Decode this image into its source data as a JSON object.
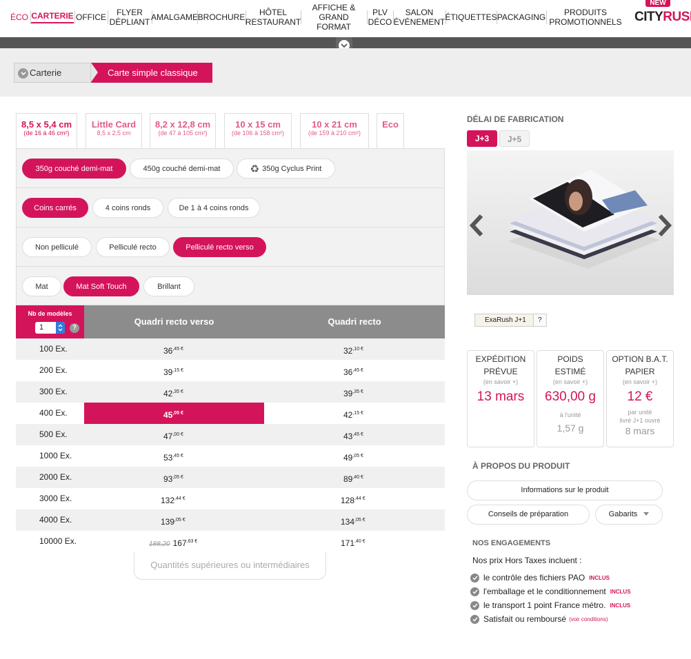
{
  "nav": {
    "items": [
      {
        "label": "ÉCO"
      },
      {
        "label": "CARTERIE"
      },
      {
        "label": "OFFICE"
      },
      {
        "label": "FLYER\nDÉPLIANT"
      },
      {
        "label": "AMALGAME"
      },
      {
        "label": "BROCHURE"
      },
      {
        "label": "HÔTEL\nRESTAURANT"
      },
      {
        "label": "AFFICHE &\nGRAND FORMAT"
      },
      {
        "label": "PLV\nDÉCO"
      },
      {
        "label": "SALON\nÉVÉNEMENT"
      },
      {
        "label": "ÉTIQUETTES"
      },
      {
        "label": "PACKAGING"
      },
      {
        "label": "PRODUITS\nPROMOTIONNELS"
      }
    ],
    "logo_badge": "NEW",
    "logo_part1": "CITY",
    "logo_part2": "RUSH"
  },
  "breadcrumb": {
    "home": "Carterie",
    "current": "Carte simple classique"
  },
  "formats": [
    {
      "title": "8,5 x 5,4 cm",
      "sub": "(de 16 à 46 cm²)"
    },
    {
      "title": "Little Card",
      "sub": "8,5 x 2,5 cm"
    },
    {
      "title": "8,2 x 12,8 cm",
      "sub": "(de 47 à 105 cm²)"
    },
    {
      "title": "10 x 15 cm",
      "sub": "(de 106 à 158 cm²)"
    },
    {
      "title": "10 x 21 cm",
      "sub": "(de 159 à 210 cm²)"
    },
    {
      "title": "Eco",
      "sub": ""
    }
  ],
  "paper": [
    "350g couché demi-mat",
    "450g couché demi-mat",
    "350g Cyclus Print"
  ],
  "corners": [
    "Coins carrés",
    "4 coins ronds",
    "De 1 à 4 coins ronds"
  ],
  "lamination": [
    "Non pelliculé",
    "Pelliculé recto",
    "Pelliculé recto verso"
  ],
  "finish": [
    "Mat",
    "Mat Soft Touch",
    "Brillant"
  ],
  "table": {
    "models_label": "Nb de modèles",
    "models_value": "1",
    "help": "?",
    "col1": "Quadri recto verso",
    "col2": "Quadri recto",
    "rows": [
      {
        "qty": "100 Ex.",
        "p1": "36",
        "p1c": ",45 €",
        "p2": "32",
        "p2c": ",10 €"
      },
      {
        "qty": "200 Ex.",
        "p1": "39",
        "p1c": ",15 €",
        "p2": "36",
        "p2c": ",45 €"
      },
      {
        "qty": "300 Ex.",
        "p1": "42",
        "p1c": ",35 €",
        "p2": "39",
        "p2c": ",35 €"
      },
      {
        "qty": "400 Ex.",
        "p1": "45",
        "p1c": ",05 €",
        "p2": "42",
        "p2c": ",15 €"
      },
      {
        "qty": "500 Ex.",
        "p1": "47",
        "p1c": ",00 €",
        "p2": "43",
        "p2c": ",45 €"
      },
      {
        "qty": "1000 Ex.",
        "p1": "53",
        "p1c": ",45 €",
        "p2": "49",
        "p2c": ",05 €"
      },
      {
        "qty": "2000 Ex.",
        "p1": "93",
        "p1c": ",05 €",
        "p2": "89",
        "p2c": ",40 €"
      },
      {
        "qty": "3000 Ex.",
        "p1": "132",
        "p1c": ",44 €",
        "p2": "128",
        "p2c": ",44 €"
      },
      {
        "qty": "4000 Ex.",
        "p1": "139",
        "p1c": ",05 €",
        "p2": "134",
        "p2c": ",05 €"
      },
      {
        "qty": "10000 Ex.",
        "old": "188,20",
        "p1": "167",
        "p1c": ",63 €",
        "p2": "171",
        "p2c": ",40 €"
      }
    ],
    "more": "Quantités supérieures ou intermédiaires"
  },
  "delay": {
    "title": "DÉLAI DE FABRICATION",
    "opt1": "J+3",
    "opt2": "J+5"
  },
  "exarush": {
    "label": "ExaRush J+1",
    "help": "?"
  },
  "info": {
    "ship": {
      "title": "EXPÉDITION PRÉVUE",
      "more": "(en savoir +)",
      "value": "13 mars"
    },
    "weight": {
      "title": "POIDS ESTIMÉ",
      "more": "(en savoir +)",
      "value": "630,00 g",
      "unit_label": "à l'unité",
      "unit_value": "1,57 g"
    },
    "bat": {
      "title": "OPTION B.A.T. PAPIER",
      "more": "(en savoir +)",
      "value": "12 €",
      "unit_label": "par unité",
      "unit_label2": "livré J+1 ouvré",
      "unit_value": "8 mars"
    }
  },
  "about": {
    "title": "À PROPOS DU PRODUIT",
    "info_btn": "Informations sur le produit",
    "advice_btn": "Conseils de préparation",
    "templates_btn": "Gabarits"
  },
  "engagements": {
    "title": "NOS ENGAGEMENTS",
    "intro": "Nos prix Hors Taxes incluent :",
    "items": [
      {
        "text": "le contrôle des fichiers PAO",
        "tag": "INCLUS"
      },
      {
        "text": "l'emballage et le conditionnement",
        "tag": "INCLUS"
      },
      {
        "text": "le transport 1 point France métro.",
        "tag": "INCLUS"
      },
      {
        "text": "Satisfait ou remboursé",
        "tag": "(voir conditions)"
      }
    ]
  },
  "colors": {
    "accent": "#d4145a",
    "header_gray": "#8c8c8c"
  }
}
